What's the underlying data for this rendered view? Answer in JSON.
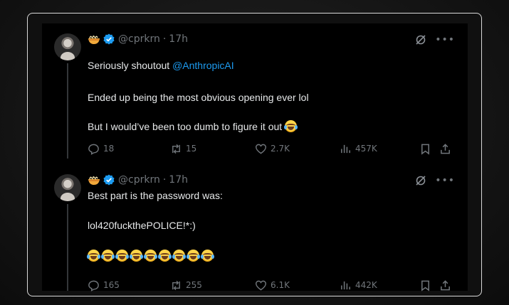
{
  "tweets": [
    {
      "handle": "@cprkrn",
      "sep": "·",
      "time": "17h",
      "lines": [
        {
          "pre": "Seriously shoutout ",
          "mention": "@AnthropicAI"
        },
        {
          "pre": "Ended up being the most obvious opening ever lol"
        },
        {
          "pre": "But I would’ve been too dumb to figure it out ",
          "emoji": 1
        }
      ],
      "replies": "18",
      "reposts": "15",
      "likes": "2.7K",
      "views": "457K"
    },
    {
      "handle": "@cprkrn",
      "sep": "·",
      "time": "17h",
      "lines": [
        {
          "pre": "Best part is the password was:"
        },
        {
          "pre": "lol420fuckthePOLICE!*:)"
        },
        {
          "pre": "",
          "emoji": 9
        }
      ],
      "replies": "165",
      "reposts": "255",
      "likes": "6.1K",
      "views": "442K"
    }
  ],
  "icons": {
    "noodle": "noodle-bowl-emoji",
    "verified": "verified-badge-icon",
    "emoji": "face-with-tears-of-joy-emoji",
    "accent": "#1d9bf0",
    "muted": "#71767b"
  }
}
